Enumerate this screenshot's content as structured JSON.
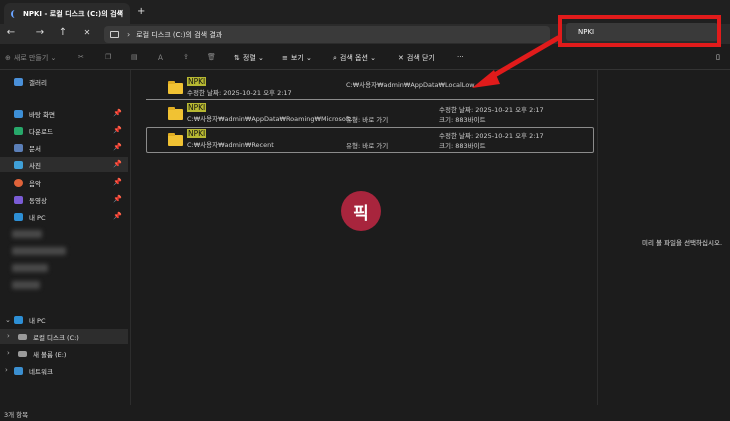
{
  "tab": {
    "title": "NPKI - 로컬 디스크 (C:)의 검색",
    "close_icon": "close-icon",
    "new_tab": "+"
  },
  "nav": {
    "back": "←",
    "forward": "→",
    "up": "↑",
    "close": "✕"
  },
  "address": {
    "text": "로컬 디스크 (C:)의 검색 결과",
    "chevron": "›"
  },
  "search": {
    "value": "NPKI"
  },
  "toolbar": {
    "new": "새로 만들기",
    "sort": "정렬",
    "view": "보기",
    "search_options": "검색 옵션",
    "close_search": "검색 닫기",
    "more": "···"
  },
  "sidebar": {
    "gallery": "갤러리",
    "desktop": "바탕 화면",
    "downloads": "다운로드",
    "documents": "문서",
    "pictures": "사진",
    "music": "음악",
    "videos": "동영상",
    "mypc_pinned": "내 PC",
    "mypc": "내 PC",
    "local_disk": "로컬 디스크 (C:)",
    "new_volume": "새 볼륨 (E:)",
    "network": "네트워크"
  },
  "results": [
    {
      "name": "NPKI",
      "line2": "수정한 날짜: 2025-10-21 오후 2:17",
      "path": "C:₩사용자₩admin₩AppData₩LocalLow",
      "col3_a": "",
      "col3_b": ""
    },
    {
      "name": "NPKI",
      "line2": "C:₩사용자₩admin₩AppData₩Roaming₩Microsoft...",
      "path": "유형: 바로 가기",
      "col3_a": "수정한 날짜: 2025-10-21 오후 2:17",
      "col3_b": "크기: 883바이트"
    },
    {
      "name": "NPKI",
      "line2": "C:₩사용자₩admin₩Recent",
      "path": "유형: 바로 가기",
      "col3_a": "수정한 날짜: 2025-10-21 오후 2:17",
      "col3_b": "크기: 883바이트"
    }
  ],
  "watermark": "픽",
  "preview": {
    "text": "미리 볼 파일을 선택하십시오."
  },
  "status": {
    "text": "3개 항목"
  },
  "colors": {
    "highlight": "#e11b1b",
    "folder": "#f1c233",
    "match": "#b7b832"
  }
}
